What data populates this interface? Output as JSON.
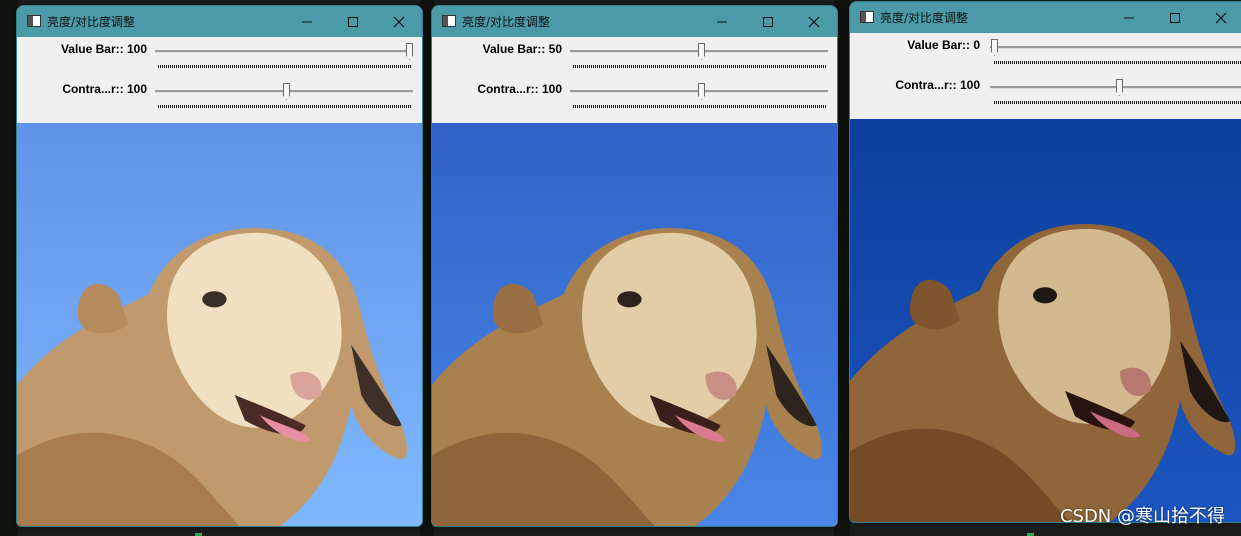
{
  "windows": [
    {
      "title": "亮度/对比度调整",
      "value_bar": {
        "label": "Value Bar:: 100",
        "level": 1.0
      },
      "contrast_bar": {
        "label": "Contra...r:: 100",
        "level": 0.5
      },
      "sky": {
        "top": "#5f93e6",
        "bottom": "#80b8ff"
      }
    },
    {
      "title": "亮度/对比度调整",
      "value_bar": {
        "label": "Value Bar:: 50",
        "level": 0.5
      },
      "contrast_bar": {
        "label": "Contra...r:: 100",
        "level": 0.5
      },
      "sky": {
        "top": "#2f63c8",
        "bottom": "#4a86e8"
      }
    },
    {
      "title": "亮度/对比度调整",
      "value_bar": {
        "label": "Value Bar:: 0",
        "level": 0.0
      },
      "contrast_bar": {
        "label": "Contra...r:: 100",
        "level": 0.5
      },
      "sky": {
        "top": "#0d3f9e",
        "bottom": "#1c56c0"
      }
    }
  ],
  "watermark": "CSDN @寒山拾不得",
  "colors": {
    "titlebar": "#4a9aa8",
    "client": "#f0f0f0",
    "console": "#101210"
  }
}
